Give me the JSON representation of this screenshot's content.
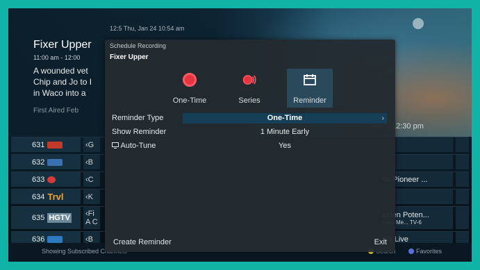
{
  "background": {
    "top_time": "12:5  Thu, Jan 24 10:54 am",
    "show_title": "Fixer Upper",
    "time_slot": "11:00 am - 12:00",
    "description_lines": [
      "A wounded vet",
      "Chip and Jo to I",
      "in Waco into a"
    ],
    "first_aired": "First Aired Feb",
    "clock": "12:30 pm"
  },
  "guide": {
    "rows": [
      {
        "number": "631",
        "logo_color": "#c23a2a",
        "prev": "‹G",
        "right": ""
      },
      {
        "number": "632",
        "logo_color": "#3a6fb0",
        "prev": "‹B",
        "right": ""
      },
      {
        "number": "633",
        "logo_color": "#d63b3b",
        "prev": "‹C",
        "right": "ne Pioneer ..."
      },
      {
        "number": "634",
        "logo_text": "Trvl",
        "logo_color": "#f2a12b",
        "prev": "‹K",
        "right": ""
      },
      {
        "number": "635",
        "logo_text": "HGTV",
        "logo_color": "#6c8a99",
        "prev": "‹Fi",
        "prev2": "A C",
        "right": "idden Poten...",
        "right_sub": "hane Me...  TV-6"
      },
      {
        "number": "636",
        "logo_color": "#2c7bc2",
        "prev": "‹B",
        "right": "TN Live"
      }
    ]
  },
  "footer": {
    "status": "Showing Subscribed Channels",
    "search_label": "Search",
    "favorites_label": "Favorites",
    "search_color": "#f2d22b",
    "favorites_color": "#5a6fe0"
  },
  "modal": {
    "header": "Schedule Recording",
    "show_title": "Fixer Upper",
    "options": [
      {
        "label": "One-Time",
        "icon": "record-icon"
      },
      {
        "label": "Series",
        "icon": "series-record-icon"
      },
      {
        "label": "Reminder",
        "icon": "calendar-icon",
        "selected": true
      }
    ],
    "settings": [
      {
        "label": "Reminder Type",
        "value": "One-Time",
        "active": true
      },
      {
        "label": "Show Reminder",
        "value": "1 Minute Early"
      },
      {
        "label": "Auto-Tune",
        "value": "Yes",
        "icon": "tv-icon"
      }
    ],
    "create_label": "Create Reminder",
    "exit_label": "Exit",
    "accent_color": "#e5333f"
  }
}
